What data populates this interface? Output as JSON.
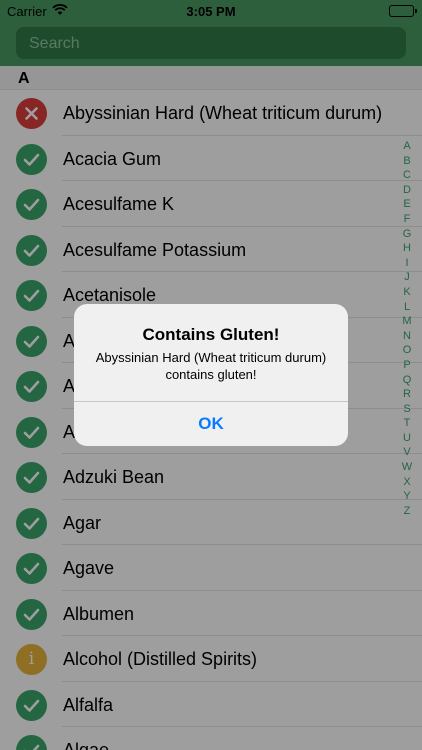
{
  "status_bar": {
    "carrier": "Carrier",
    "time": "3:05 PM"
  },
  "search": {
    "placeholder": "Search"
  },
  "section": {
    "title": "A"
  },
  "items": [
    {
      "label": "Abyssinian Hard (Wheat triticum durum)",
      "status": "bad"
    },
    {
      "label": "Acacia Gum",
      "status": "ok"
    },
    {
      "label": "Acesulfame K",
      "status": "ok"
    },
    {
      "label": "Acesulfame Potassium",
      "status": "ok"
    },
    {
      "label": "Acetanisole",
      "status": "ok"
    },
    {
      "label": "A",
      "status": "ok"
    },
    {
      "label": "A",
      "status": "ok"
    },
    {
      "label": "A",
      "status": "ok"
    },
    {
      "label": "Adzuki Bean",
      "status": "ok"
    },
    {
      "label": "Agar",
      "status": "ok"
    },
    {
      "label": "Agave",
      "status": "ok"
    },
    {
      "label": "Albumen",
      "status": "ok"
    },
    {
      "label": "Alcohol (Distilled Spirits)",
      "status": "info"
    },
    {
      "label": "Alfalfa",
      "status": "ok"
    },
    {
      "label": "Algae",
      "status": "ok"
    }
  ],
  "index_letters": [
    "A",
    "B",
    "C",
    "D",
    "E",
    "F",
    "G",
    "H",
    "I",
    "J",
    "K",
    "L",
    "M",
    "N",
    "O",
    "P",
    "Q",
    "R",
    "S",
    "T",
    "U",
    "V",
    "W",
    "X",
    "Y",
    "Z"
  ],
  "alert": {
    "title": "Contains Gluten!",
    "message": "Abyssinian Hard (Wheat triticum durum) contains gluten!",
    "button": "OK"
  },
  "colors": {
    "header_green": "#4a9a63",
    "ok_green": "#3aa56b",
    "error_red": "#dc3d3d",
    "info_yellow": "#e5b33a",
    "ios_blue": "#0a7aff"
  }
}
